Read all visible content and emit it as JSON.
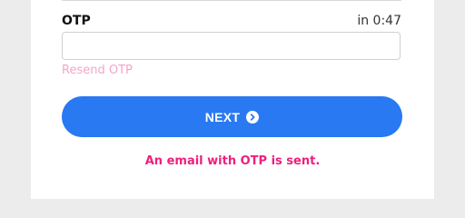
{
  "otp": {
    "label": "OTP",
    "timer": "in 0:47",
    "value": "",
    "placeholder": ""
  },
  "resend_label": "Resend OTP",
  "next_button": {
    "label": "NEXT",
    "icon": "arrow-circle-right-icon"
  },
  "status_message": "An email with OTP is sent.",
  "colors": {
    "accent": "#2979f2",
    "resend_link": "#f3a5c8",
    "status_text": "#ee1f7c",
    "background": "#ececec"
  }
}
